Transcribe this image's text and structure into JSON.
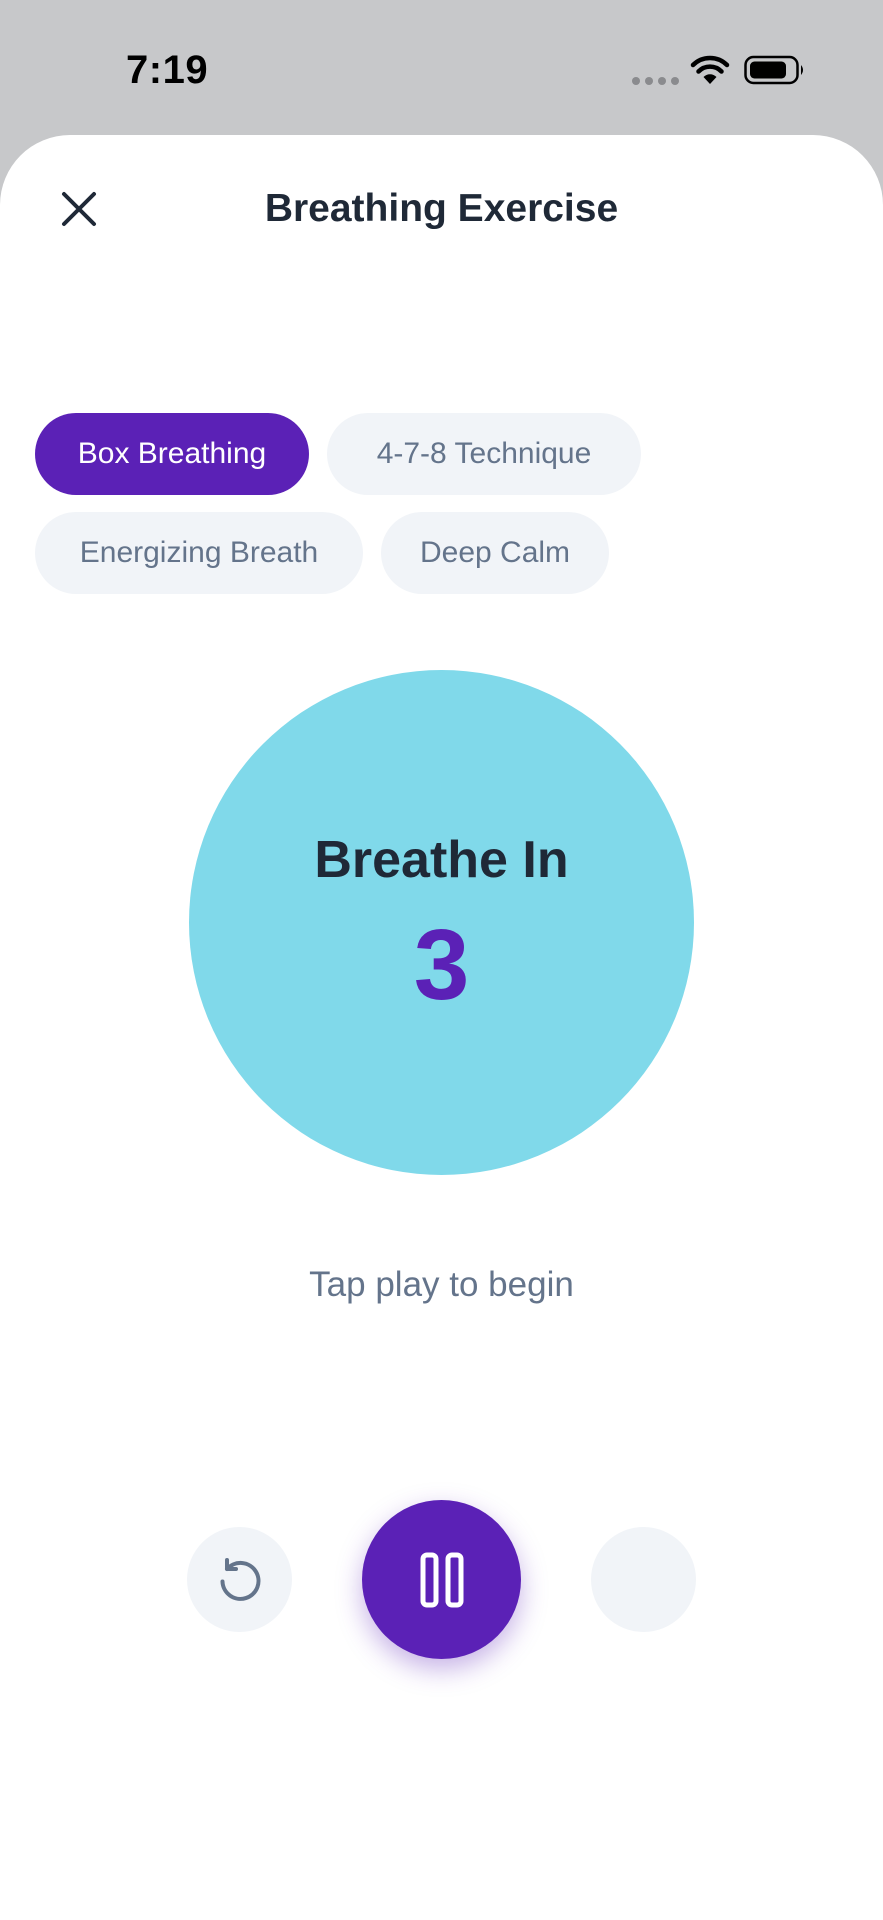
{
  "status_bar": {
    "time": "7:19",
    "icons": [
      "signal-dots-icon",
      "wifi-icon",
      "battery-icon"
    ]
  },
  "header": {
    "close_icon": "close-icon",
    "title": "Breathing Exercise"
  },
  "techniques": {
    "items": [
      {
        "label": "Box Breathing",
        "selected": true
      },
      {
        "label": "4-7-8 Technique",
        "selected": false
      },
      {
        "label": "Energizing Breath",
        "selected": false
      },
      {
        "label": "Deep Calm",
        "selected": false
      }
    ]
  },
  "breath": {
    "phase": "Breathe In",
    "count": "3"
  },
  "hint": "Tap play to begin",
  "controls": {
    "reset_icon": "reset-icon",
    "pause_icon": "pause-icon"
  },
  "colors": {
    "accent": "#5b21b6",
    "circle": "#80d9ea",
    "chip_bg": "#f1f4f8",
    "title_text": "#1f2937",
    "muted_text": "#64748b"
  }
}
